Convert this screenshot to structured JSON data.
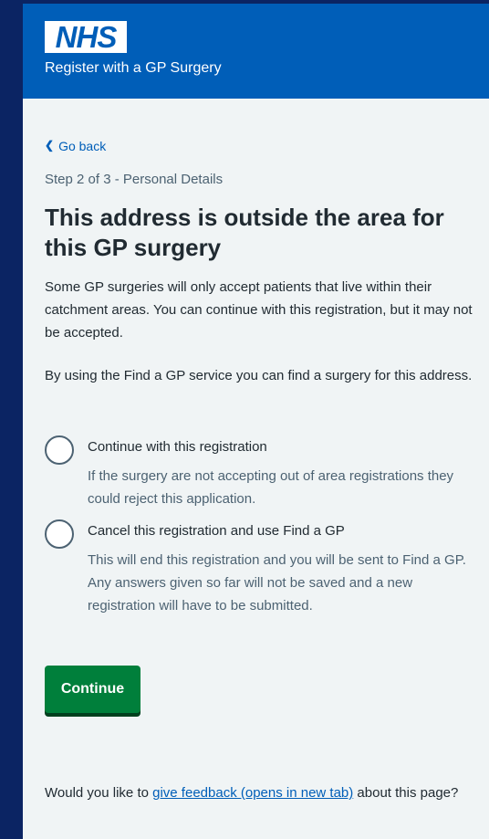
{
  "header": {
    "logo_text": "NHS",
    "service_name": "Register with a GP Surgery",
    "brand_color": "#005eb8"
  },
  "nav": {
    "back_label": "Go back",
    "back_icon": "chevron-left-icon"
  },
  "page": {
    "step": "Step 2 of 3 - Personal Details",
    "title": "This address is outside the area for this GP surgery",
    "intro": "Some GP surgeries will only accept patients that live within their catchment areas. You can continue with this registration, but it may not be accepted.",
    "find_gp_text": "By using the Find a GP service you can find a surgery for this address."
  },
  "options": [
    {
      "label": "Continue with this registration",
      "hint": "If the surgery are not accepting out of area registrations they could reject this application.",
      "selected": false
    },
    {
      "label": "Cancel this registration and use Find a GP",
      "hint": "This will end this registration and you will be sent to Find a GP. Any answers given so far will not be saved and a new registration will have to be submitted.",
      "selected": false
    }
  ],
  "actions": {
    "continue_label": "Continue",
    "button_color": "#007f3b"
  },
  "feedback": {
    "prefix": "Would you like to ",
    "link_text": "give feedback (opens in new tab)",
    "suffix": " about this page?"
  }
}
